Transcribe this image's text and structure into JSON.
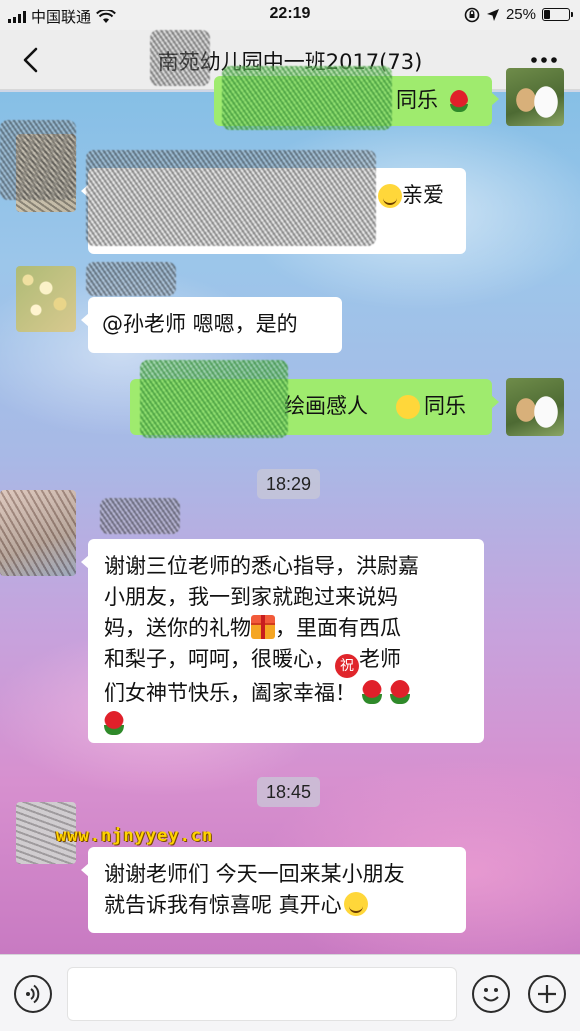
{
  "status_bar": {
    "carrier": "中国联通",
    "time": "22:19",
    "battery": "25%",
    "battery_level": 0.25
  },
  "header": {
    "title": "南苑幼儿园中一班2017(73)"
  },
  "messages": [
    {
      "side": "right",
      "text": "同乐"
    },
    {
      "side": "left",
      "text": "亲爱"
    },
    {
      "side": "left",
      "text": "@孙老师 嗯嗯，是的"
    },
    {
      "side": "right",
      "text": "绘画感人",
      "text2": "同乐"
    },
    {
      "side": "left",
      "lines": [
        "谢谢三位老师的悉心指导，洪尉嘉",
        "小朋友，我一到家就跑过来说妈",
        "妈，送你的礼物",
        "，里面有西瓜",
        "和梨子，呵呵，很暖心，",
        "老师",
        "们女神节快乐，阖家幸福！"
      ]
    },
    {
      "side": "left",
      "lines": [
        "谢谢老师们 今天一回来某小朋友",
        "就告诉我有惊喜呢 真开心"
      ]
    }
  ],
  "timestamps": [
    "18:29",
    "18:45"
  ],
  "emoji_zhu": "祝",
  "watermark": "www.njnyyey.cn",
  "icons": [
    "back-icon",
    "more-icon",
    "voice-icon",
    "emoji-icon",
    "add-icon"
  ]
}
